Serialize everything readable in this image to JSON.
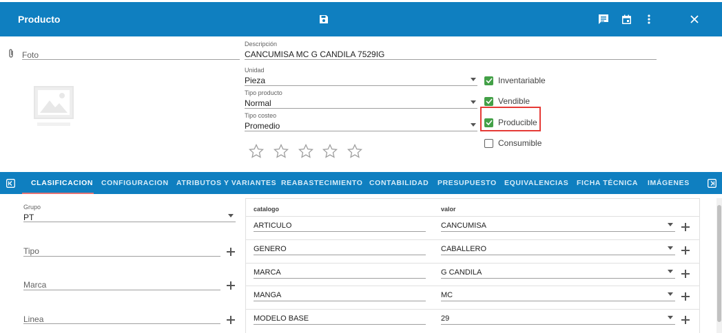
{
  "header": {
    "title": "Producto"
  },
  "photo": {
    "label": "Foto"
  },
  "descripcion": {
    "label": "Descripción",
    "value": "CANCUMISA MC G CANDILA 7529IG"
  },
  "unidad": {
    "label": "Unidad",
    "value": "Pieza"
  },
  "tipo_producto": {
    "label": "Tipo producto",
    "value": "Normal"
  },
  "tipo_costeo": {
    "label": "Tipo costeo",
    "value": "Promedio"
  },
  "checks": [
    {
      "label": "Inventariable",
      "checked": true
    },
    {
      "label": "Vendible",
      "checked": true
    },
    {
      "label": "Producible",
      "checked": true
    },
    {
      "label": "Consumible",
      "checked": false
    }
  ],
  "rating": {
    "max": 5,
    "value": 0
  },
  "tabs": [
    "CLASIFICACION",
    "CONFIGURACION",
    "ATRIBUTOS Y VARIANTES",
    "REABASTECIMIENTO",
    "CONTABILIDAD",
    "PRESUPUESTO",
    "EQUIVALENCIAS",
    "FICHA TÉCNICA",
    "IMÁGENES"
  ],
  "active_tab": "CLASIFICACION",
  "left_fields": {
    "grupo": {
      "label": "Grupo",
      "value": "PT"
    },
    "tipo": {
      "label": "Tipo"
    },
    "marca": {
      "label": "Marca"
    },
    "linea": {
      "label": "Linea"
    }
  },
  "catalog": {
    "headers": {
      "catalogo": "catalogo",
      "valor": "valor"
    },
    "rows": [
      {
        "catalogo": "ARTICULO",
        "valor": "CANCUMISA"
      },
      {
        "catalogo": "GENERO",
        "valor": "CABALLERO"
      },
      {
        "catalogo": "MARCA",
        "valor": "G CANDILA"
      },
      {
        "catalogo": "MANGA",
        "valor": "MC"
      },
      {
        "catalogo": "MODELO BASE",
        "valor": "29"
      }
    ]
  },
  "colors": {
    "primary": "#0f7fc0",
    "check": "#43a047",
    "highlight": "#e53935"
  }
}
